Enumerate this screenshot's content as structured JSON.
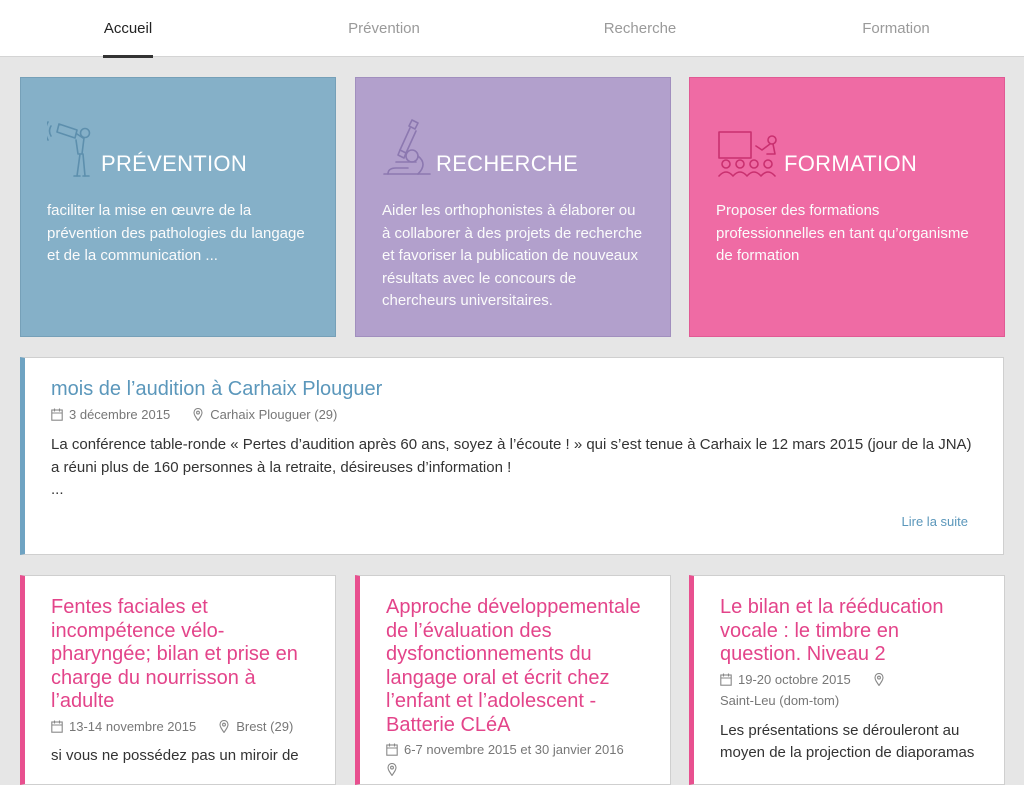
{
  "nav": {
    "tabs": [
      {
        "label": "Accueil",
        "active": true
      },
      {
        "label": "Prévention",
        "active": false
      },
      {
        "label": "Recherche",
        "active": false
      },
      {
        "label": "Formation",
        "active": false
      }
    ]
  },
  "colors": {
    "prevention": "#85b0c8",
    "recherche": "#b2a0cc",
    "formation": "#ef6ba4",
    "news_accent": "#5b97bb",
    "event_accent": "#e3448a"
  },
  "tiles": [
    {
      "title": "PRÉVENTION",
      "icon": "megaphone-person-icon",
      "text": "faciliter la mise en œuvre de la prévention des pathologies du langage et de la communication ..."
    },
    {
      "title": "RECHERCHE",
      "icon": "microscope-icon",
      "text": "Aider les orthophonistes à élaborer ou à collaborer à des projets de recherche et favoriser la publication de nouveaux résultats avec le concours de chercheurs universitaires."
    },
    {
      "title": "FORMATION",
      "icon": "classroom-icon",
      "text": "Proposer des formations professionnelles en tant qu’organisme de formation"
    }
  ],
  "news": {
    "title": "mois de l’audition à Carhaix Plouguer",
    "date": "3 décembre 2015",
    "location": "Carhaix Plouguer (29)",
    "text": "La conférence table-ronde « Pertes d’audition après 60 ans, soyez à l’écoute ! » qui s’est tenue à Carhaix le 12 mars 2015 (jour de la JNA) a réuni plus de 160 personnes à la retraite, désireuses d’information !",
    "ellipsis": "...",
    "read_more": "Lire la suite"
  },
  "events": [
    {
      "title": "Fentes faciales et incompétence vélo-pharyngée; bilan et prise en charge du nourrisson à l’adulte",
      "date": "13-14 novembre 2015",
      "location": "Brest (29)",
      "text": "si vous ne possédez pas un miroir de"
    },
    {
      "title": "Approche développementale de l’évaluation des dysfonctionnements du langage oral et écrit chez l’enfant et l’adolescent - Batterie CLéA",
      "date": "6-7 novembre 2015 et 30 janvier 2016",
      "location": "",
      "text": ""
    },
    {
      "title": "Le bilan et la rééducation vocale : le timbre en question. Niveau 2",
      "date": "19-20 octobre 2015",
      "location": "Saint-Leu (dom-tom)",
      "text": "Les présentations se dérouleront au moyen de la projection de diaporamas"
    }
  ]
}
